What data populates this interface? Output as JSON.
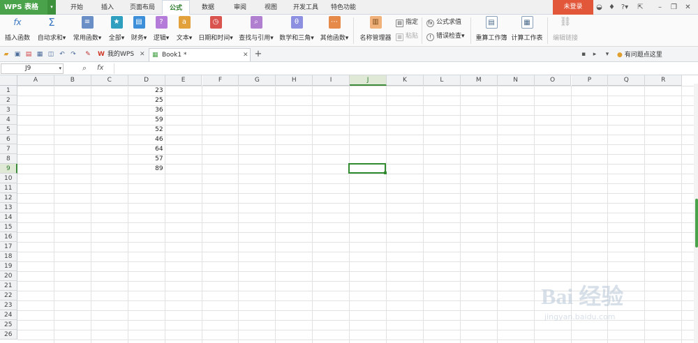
{
  "app": {
    "logo": "WPS 表格",
    "login": "未登录",
    "help": "?"
  },
  "menu": [
    "开始",
    "插入",
    "页面布局",
    "公式",
    "数据",
    "审阅",
    "视图",
    "开发工具",
    "特色功能"
  ],
  "ribbon": {
    "buttons": [
      {
        "label": "插入函数",
        "color": "#3a78c2",
        "glyph": "fx"
      },
      {
        "label": "自动求和",
        "color": "#3a78c2",
        "glyph": "Σ"
      },
      {
        "label": "常用函数",
        "color": "#6a8fc7",
        "glyph": "≡"
      },
      {
        "label": "全部",
        "color": "#2f9fc0",
        "glyph": "★"
      },
      {
        "label": "财务",
        "color": "#3c8fd8",
        "glyph": "▤"
      },
      {
        "label": "逻辑",
        "color": "#4aa34a",
        "glyph": "▦"
      },
      {
        "label": "文本",
        "color": "#b47cd8",
        "glyph": "?"
      },
      {
        "label": "日期和时间",
        "color": "#e3a13c",
        "glyph": "a"
      },
      {
        "label": "查找与引用",
        "color": "#d9534f",
        "glyph": "◷"
      },
      {
        "label": "数学和三角",
        "color": "#b07fd0",
        "glyph": "⌕"
      },
      {
        "label": "其他函数",
        "color": "#8d8fe0",
        "glyph": "θ"
      },
      {
        "label": "名称管理器",
        "color": "#e68a4a",
        "glyph": "⋯"
      }
    ],
    "name_manager": "名称管理器",
    "specify": "指定",
    "paste": "粘贴",
    "formula_eval": "公式求值",
    "error_check": "错误检查",
    "recalc_workbook": "重算工作簿",
    "calc_sheet": "计算工作表",
    "edit_links": "编辑链接"
  },
  "tabs": {
    "my_wps": "我的WPS",
    "book": "Book1 *",
    "help_link": "有问题点这里"
  },
  "formula": {
    "cell_ref": "J9",
    "fx": "fx",
    "value": ""
  },
  "columns": [
    "A",
    "B",
    "C",
    "D",
    "E",
    "F",
    "G",
    "H",
    "I",
    "J",
    "K",
    "L",
    "M",
    "N",
    "O",
    "P",
    "Q",
    "R"
  ],
  "rows": [
    "1",
    "2",
    "3",
    "4",
    "5",
    "6",
    "7",
    "8",
    "9",
    "10",
    "11",
    "12",
    "13",
    "14",
    "15",
    "16",
    "17",
    "18",
    "19",
    "20",
    "21",
    "22",
    "23",
    "24",
    "25",
    "26"
  ],
  "column_d_values": [
    "23",
    "25",
    "36",
    "59",
    "52",
    "46",
    "64",
    "57",
    "89"
  ],
  "selected": {
    "column": "J",
    "row": "9"
  },
  "watermark": {
    "main": "Bai 经验",
    "sub": "jingyan.baidu.com"
  }
}
